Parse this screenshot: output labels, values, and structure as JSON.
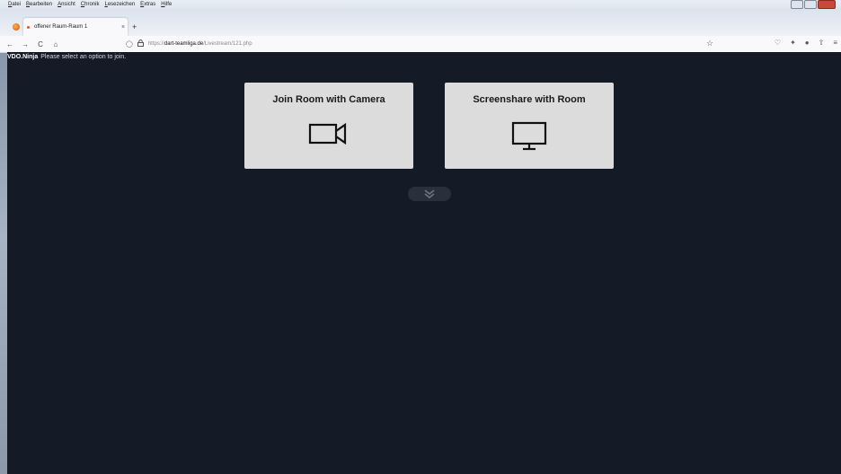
{
  "menubar": {
    "items": [
      {
        "u": "D",
        "rest": "atei"
      },
      {
        "u": "B",
        "rest": "earbeiten"
      },
      {
        "u": "A",
        "rest": "nsicht"
      },
      {
        "u": "C",
        "rest": "hronik"
      },
      {
        "u": "L",
        "rest": "esezeichen"
      },
      {
        "u": "E",
        "rest": "xtras"
      },
      {
        "u": "H",
        "rest": "ilfe"
      }
    ]
  },
  "tab": {
    "title": "offener Raum-Raum 1",
    "close": "×"
  },
  "newtab": "+",
  "nav": {
    "back": "←",
    "forward": "→",
    "reload": "C",
    "home": "⌂"
  },
  "url": {
    "scheme": "https://",
    "host": "dart-teamliga.de",
    "path": "/Livestream/121.php"
  },
  "app": {
    "brand": "VDO.Ninja",
    "message": "Please select an option to join.",
    "cards": [
      {
        "title": "Join Room with Camera",
        "icon": "video-camera-icon"
      },
      {
        "title": "Screenshare with Room",
        "icon": "monitor-icon"
      }
    ],
    "more_icon": "double-chevron-down-icon"
  },
  "colors": {
    "app_bg": "#141a26",
    "card_bg": "#dcdcdc",
    "pill_bg": "#2a303b"
  }
}
